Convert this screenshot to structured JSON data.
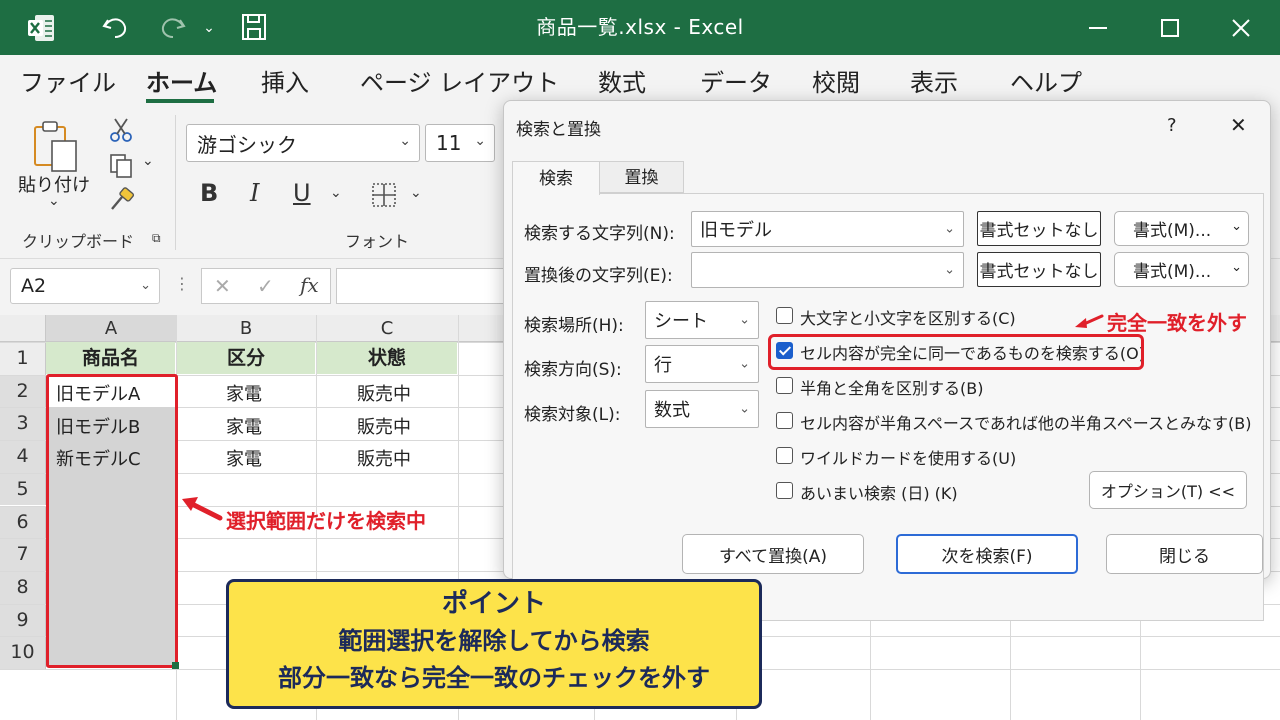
{
  "window": {
    "title": "商品一覧.xlsx  -  Excel",
    "icons": [
      "excel-logo-icon",
      "undo-icon",
      "redo-icon",
      "chevron-down-icon",
      "save-icon",
      "minimize-icon",
      "maximize-icon",
      "close-icon"
    ]
  },
  "ribbon_tabs": [
    {
      "label": "ファイル",
      "active": false
    },
    {
      "label": "ホーム",
      "active": true
    },
    {
      "label": "挿入",
      "active": false
    },
    {
      "label": "ページ レイアウト",
      "active": false
    },
    {
      "label": "数式",
      "active": false
    },
    {
      "label": "データ",
      "active": false
    },
    {
      "label": "校閲",
      "active": false
    },
    {
      "label": "表示",
      "active": false
    },
    {
      "label": "ヘルプ",
      "active": false
    }
  ],
  "ribbon": {
    "paste_label": "貼り付け",
    "clipboard_group": "クリップボード",
    "font_group": "フォント",
    "font_name": "游ゴシック",
    "font_size": "11",
    "bold": "B",
    "italic": "I",
    "underline": "U"
  },
  "formula_bar": {
    "name_box": "A2",
    "cancel": "✕",
    "enter": "✓",
    "fx": "fx"
  },
  "sheet": {
    "columns": [
      "A",
      "B",
      "C"
    ],
    "rows": [
      "1",
      "2",
      "3",
      "4",
      "5",
      "6",
      "7",
      "8",
      "9",
      "10"
    ],
    "header": [
      "商品名",
      "区分",
      "状態"
    ],
    "data": [
      [
        "旧モデルA",
        "家電",
        "販売中"
      ],
      [
        "旧モデルB",
        "家電",
        "販売中"
      ],
      [
        "新モデルC",
        "家電",
        "販売中"
      ]
    ]
  },
  "dialog": {
    "title": "検索と置換",
    "help": "?",
    "close": "✕",
    "tabs": [
      "検索",
      "置換"
    ],
    "find_label": "検索する文字列(N):",
    "find_value": "旧モデル",
    "replace_label": "置換後の文字列(E):",
    "replace_value": "",
    "no_format": "書式セットなし",
    "format_button": "書式(M)...",
    "within_label": "検索場所(H):",
    "within_value": "シート",
    "search_label": "検索方向(S):",
    "search_value": "行",
    "lookin_label": "検索対象(L):",
    "lookin_value": "数式",
    "options": [
      {
        "label": "大文字と小文字を区別する(C)",
        "checked": false
      },
      {
        "label": "セル内容が完全に同一であるものを検索する(O)",
        "checked": true
      },
      {
        "label": "半角と全角を区別する(B)",
        "checked": false
      },
      {
        "label": "セル内容が半角スペースであれば他の半角スペースとみなす(B)",
        "checked": false
      },
      {
        "label": "ワイルドカードを使用する(U)",
        "checked": false
      },
      {
        "label": "あいまい検索 (日) (K)",
        "checked": false
      }
    ],
    "options_button": "オプション(T) <<",
    "replace_all": "すべて置換(A)",
    "find_next": "次を検索(F)",
    "close_button": "閉じる"
  },
  "annotations": {
    "exact_match_note": "完全一致を外す",
    "selection_note": "選択範囲だけを検索中",
    "callout_title": "ポイント",
    "callout_line1": "範囲選択を解除してから検索",
    "callout_line2": "部分一致なら完全一致のチェックを外す",
    "accent_color": "#e0202a",
    "callout_color": "#fde34a"
  }
}
